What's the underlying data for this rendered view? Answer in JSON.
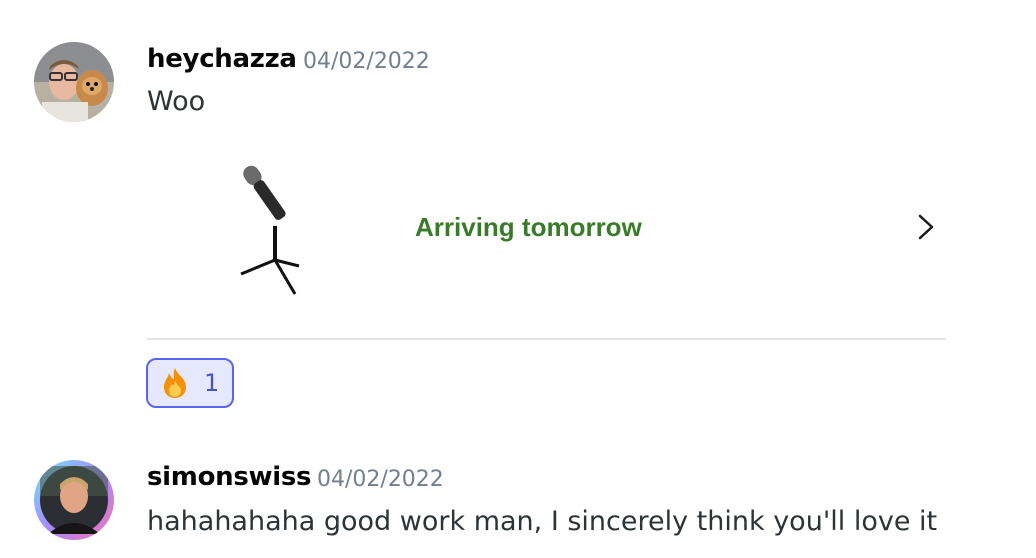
{
  "messages": [
    {
      "username": "heychazza",
      "timestamp": "04/02/2022",
      "text": "Woo",
      "avatar_icon": "user-avatar-with-dog",
      "embed": {
        "status_text": "Arriving tomorrow",
        "status_color": "#3a7b2a",
        "product_icon": "microphone-on-stand-icon",
        "chevron_icon": "chevron-right-icon"
      },
      "reactions": [
        {
          "emoji_icon": "fire-icon",
          "count": "1"
        }
      ]
    },
    {
      "username": "simonswiss",
      "timestamp": "04/02/2022",
      "text": "hahahahaha good work man, I sincerely think you'll love it",
      "avatar_icon": "user-avatar-gradient-ring"
    }
  ],
  "colors": {
    "reaction_border": "#5865f2",
    "reaction_bg": "#e6e8fd",
    "timestamp": "#747f8d"
  }
}
